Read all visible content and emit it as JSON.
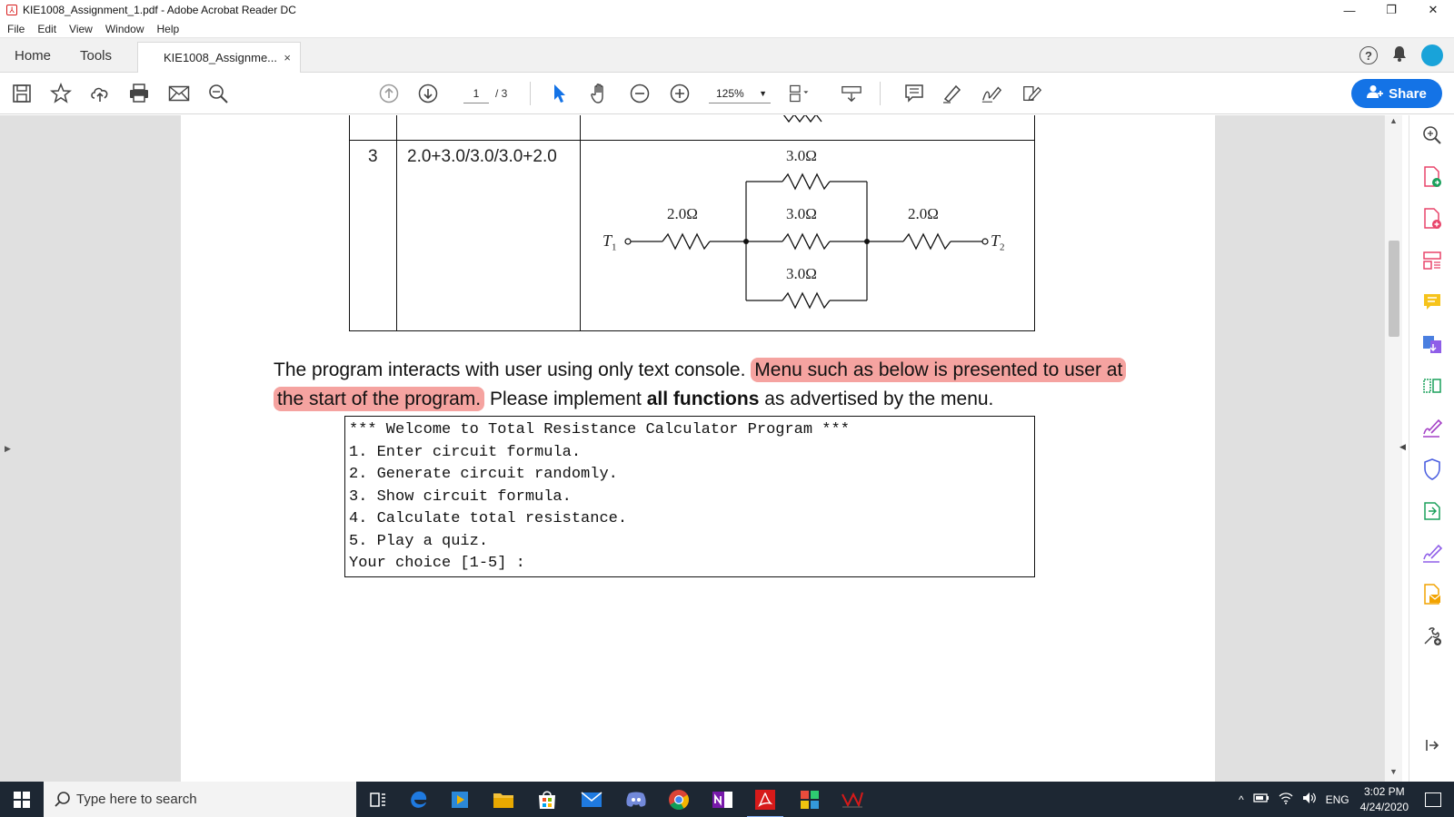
{
  "window": {
    "title": "KIE1008_Assignment_1.pdf - Adobe Acrobat Reader DC",
    "controls": [
      "—",
      "❐",
      "✕"
    ]
  },
  "menu": [
    "File",
    "Edit",
    "View",
    "Window",
    "Help"
  ],
  "tabs": {
    "home": "Home",
    "tools": "Tools",
    "document": "KIE1008_Assignme...",
    "close": "×"
  },
  "toolbar": {
    "page_current": "1",
    "page_total": "/ 3",
    "zoom": "125%",
    "share_label": "Share"
  },
  "document": {
    "table": {
      "row_number": "3",
      "formula": "2.0+3.0/3.0/3.0+2.0",
      "circuit": {
        "left_resistor": "2.0Ω",
        "right_resistor": "2.0Ω",
        "top_resistor": "3.0Ω",
        "middle_resistor": "3.0Ω",
        "bottom_resistor": "3.0Ω",
        "terminal_left": "T",
        "terminal_left_sub": "1",
        "terminal_right": "T",
        "terminal_right_sub": "2"
      }
    },
    "paragraph": {
      "part1": "The program interacts with user using only text console.",
      "highlight1": "Menu such as below is presented to user at",
      "highlight2": "the start of the program.",
      "part2": "Please implement",
      "bold": "all functions",
      "part3": "as advertised by the menu."
    },
    "console_lines": [
      "*** Welcome to Total Resistance Calculator Program ***",
      "1. Enter circuit formula.",
      "2. Generate circuit randomly.",
      "3. Show circuit formula.",
      "4. Calculate total resistance.",
      "5. Play a quiz.",
      "Your choice [1-5] :"
    ]
  },
  "taskbar": {
    "search_placeholder": "Type here to search",
    "language": "ENG",
    "time": "3:02 PM",
    "date": "4/24/2020"
  },
  "colors": {
    "accent": "#1473e6",
    "highlight": "#f5a3a0",
    "taskbar": "#1d2733"
  }
}
